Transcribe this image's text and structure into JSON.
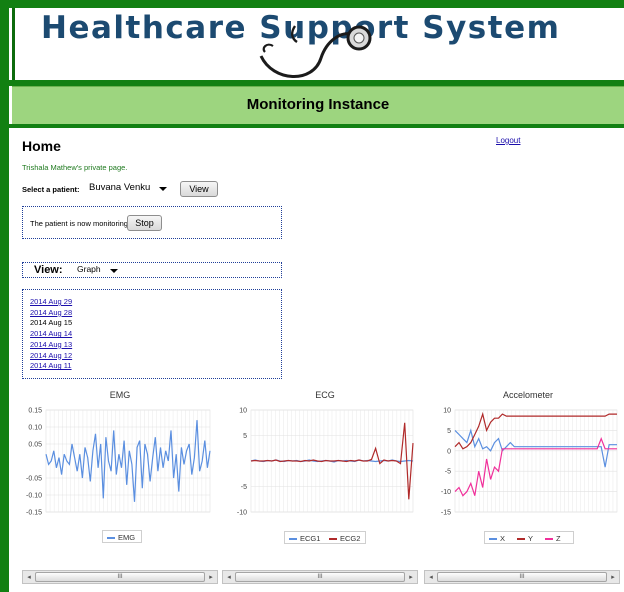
{
  "header": {
    "title": "Healthcare Support System"
  },
  "banner": {
    "label": "Monitoring Instance"
  },
  "page": {
    "heading": "Home",
    "logout_label": "Logout",
    "private_note": "Trishala Mathew's private page."
  },
  "patient_select": {
    "label": "Select a patient:",
    "selected": "Buvana Venku",
    "view_button": "View"
  },
  "monitoring": {
    "status_text": "The patient is now monitoring",
    "stop_button": "Stop"
  },
  "view_mode": {
    "label": "View:",
    "selected": "Graph"
  },
  "dates": [
    {
      "label": "2014 Aug 29",
      "link": true
    },
    {
      "label": "2014 Aug 28",
      "link": true
    },
    {
      "label": "2014 Aug 15",
      "link": false
    },
    {
      "label": "2014 Aug 14",
      "link": true
    },
    {
      "label": "2014 Aug 13",
      "link": true
    },
    {
      "label": "2014 Aug 12",
      "link": true
    },
    {
      "label": "2014 Aug 11",
      "link": true
    }
  ],
  "colors": {
    "frame_green": "#128012",
    "banner_green": "#9dd57f",
    "title_blue": "#1c4a71",
    "emg_line": "#5b8fe0",
    "ecg1_line": "#5b8fe0",
    "ecg2_line": "#b02a2a",
    "acc_x": "#5b8fe0",
    "acc_y": "#b02a2a",
    "acc_z": "#f0309a"
  },
  "chart_data": [
    {
      "type": "line",
      "title": "EMG",
      "ylim": [
        -0.15,
        0.15
      ],
      "yticks": [
        "0.15",
        "0.10",
        "0.05",
        "-0.05",
        "-0.10",
        "-0.15"
      ],
      "grid": true,
      "legend_position": "bottom",
      "series": [
        {
          "name": "EMG",
          "values": [
            0.02,
            -0.01,
            0.0,
            0.03,
            -0.02,
            0.01,
            -0.04,
            0.02,
            0.0,
            -0.01,
            0.05,
            0.01,
            -0.03,
            0.02,
            -0.05,
            0.04,
            0.01,
            -0.06,
            0.03,
            0.08,
            -0.02,
            0.05,
            -0.11,
            0.07,
            0.0,
            -0.03,
            0.09,
            -0.04,
            0.02,
            -0.02,
            0.06,
            -0.07,
            0.03,
            -0.01,
            -0.12,
            0.04,
            0.06,
            -0.08,
            0.05,
            0.02,
            -0.06,
            0.01,
            0.07,
            -0.03,
            0.04,
            -0.02,
            0.03,
            0.0,
            0.09,
            -0.05,
            0.02,
            -0.09,
            0.04,
            -0.01,
            0.03,
            0.05,
            -0.04,
            0.01,
            0.12,
            -0.03,
            0.0,
            0.06,
            -0.02,
            0.03
          ]
        }
      ]
    },
    {
      "type": "line",
      "title": "ECG",
      "ylim": [
        -10,
        10
      ],
      "yticks": [
        "10",
        "5",
        "-5",
        "-10"
      ],
      "grid": true,
      "legend_position": "bottom",
      "series": [
        {
          "name": "ECG1",
          "values": [
            0,
            0.2,
            0,
            -0.1,
            0.1,
            0,
            0.2,
            0,
            -0.1,
            0.1,
            0,
            0.1,
            -0.1,
            0,
            0.2,
            0,
            -0.1,
            0,
            0.1,
            0,
            -0.2,
            0.1,
            0,
            0.1,
            0,
            -0.1,
            0.2,
            0,
            0.1,
            0,
            -0.1,
            0,
            0.1,
            0,
            0.2,
            0,
            -0.1,
            0,
            0.1,
            0
          ]
        },
        {
          "name": "ECG2",
          "values": [
            0,
            0.1,
            0,
            0,
            0.1,
            0,
            0.2,
            -0.1,
            0,
            0.1,
            0,
            0,
            -0.1,
            0.1,
            0,
            0.2,
            0,
            -0.1,
            0.1,
            0,
            0,
            0.1,
            0,
            -0.1,
            0.1,
            0,
            0.2,
            0,
            0,
            0.3,
            2.5,
            -0.5,
            0.2,
            0,
            0.1,
            0,
            -0.5,
            7.5,
            -7.5,
            3.5
          ]
        }
      ]
    },
    {
      "type": "line",
      "title": "Accelometer",
      "ylim": [
        -15,
        10
      ],
      "yticks": [
        "10",
        "5",
        "0",
        "-5",
        "-10",
        "-15"
      ],
      "grid": true,
      "legend_position": "bottom",
      "series": [
        {
          "name": "X",
          "values": [
            5,
            4,
            3,
            2,
            5,
            1,
            3,
            0.5,
            1,
            0,
            2,
            3,
            0,
            1,
            2,
            1,
            1,
            1,
            1,
            1,
            1,
            1,
            1,
            1,
            1,
            1,
            1,
            1,
            1,
            1,
            1,
            1,
            1,
            1,
            1,
            1,
            1,
            1,
            -4,
            1.5,
            1.5,
            1.5
          ]
        },
        {
          "name": "Y",
          "values": [
            1,
            2,
            0.5,
            1,
            2,
            4,
            6,
            9,
            5,
            7,
            8,
            8,
            9,
            8.5,
            8.5,
            8.5,
            8.5,
            8.5,
            8.5,
            8.5,
            8.5,
            8.5,
            8.5,
            8.5,
            8.5,
            8.5,
            8.5,
            8.5,
            8.5,
            8.5,
            8.5,
            8.5,
            8.5,
            8.5,
            8.5,
            8.5,
            8.5,
            8.5,
            8.5,
            9,
            9,
            9
          ]
        },
        {
          "name": "Z",
          "values": [
            -10,
            -9,
            -11,
            -10,
            -8,
            -11,
            -5,
            -9,
            -2,
            -7,
            -4,
            -5,
            0.5,
            0.5,
            0.5,
            0.5,
            0.5,
            0.5,
            0.5,
            0.5,
            0.5,
            0.5,
            0.5,
            0.5,
            0.5,
            0.5,
            0.5,
            0.5,
            0.5,
            0.5,
            0.5,
            0.5,
            0.5,
            0.5,
            0.5,
            0.5,
            0.5,
            3,
            0.5,
            0.5,
            0.5,
            0.5
          ]
        }
      ]
    }
  ],
  "scrollbars": {
    "thumb_glyph": "III",
    "left_arrow": "◂",
    "right_arrow": "▸"
  }
}
